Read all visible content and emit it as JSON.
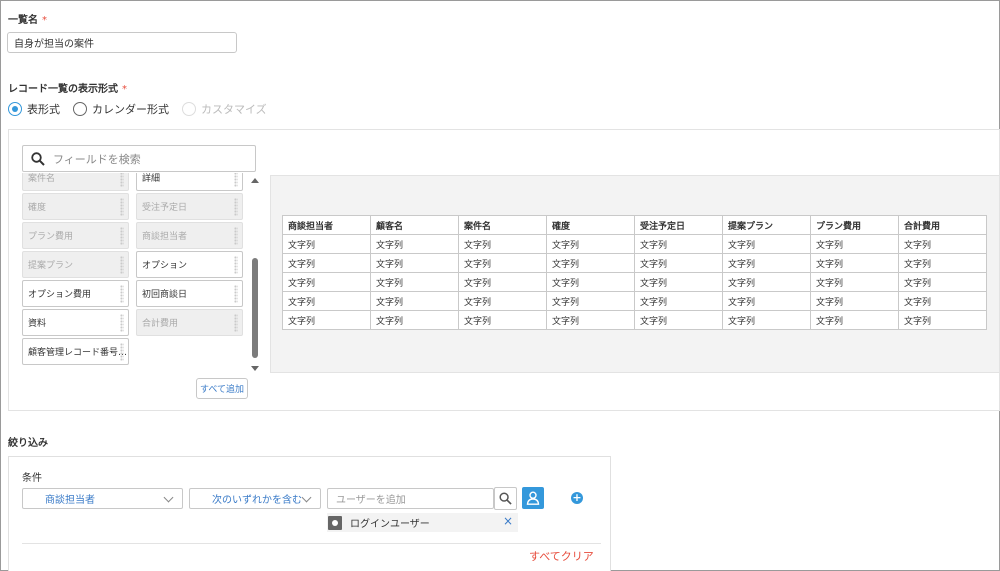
{
  "list_name": {
    "label": "一覧名",
    "required_mark": "*",
    "value": "自身が担当の案件"
  },
  "display_format": {
    "label": "レコード一覧の表示形式",
    "required_mark": "*",
    "options": [
      {
        "label": "表形式",
        "checked": true,
        "disabled": false
      },
      {
        "label": "カレンダー形式",
        "checked": false,
        "disabled": false
      },
      {
        "label": "カスタマイズ",
        "checked": false,
        "disabled": true
      }
    ]
  },
  "field_picker": {
    "search_placeholder": "フィールドを検索",
    "fields": [
      {
        "label": "案件名",
        "disabled": true
      },
      {
        "label": "詳細",
        "disabled": false
      },
      {
        "label": "確度",
        "disabled": true
      },
      {
        "label": "受注予定日",
        "disabled": true
      },
      {
        "label": "プラン費用",
        "disabled": true
      },
      {
        "label": "商談担当者",
        "disabled": true
      },
      {
        "label": "提案プラン",
        "disabled": true
      },
      {
        "label": "オプション",
        "disabled": false
      },
      {
        "label": "オプション費用",
        "disabled": false
      },
      {
        "label": "初回商談日",
        "disabled": false
      },
      {
        "label": "資料",
        "disabled": false
      },
      {
        "label": "合計費用",
        "disabled": true
      },
      {
        "label": "顧客管理レコード番号…",
        "disabled": false
      }
    ],
    "add_all_label": "すべて追加"
  },
  "preview_table": {
    "columns": [
      "商談担当者",
      "顧客名",
      "案件名",
      "確度",
      "受注予定日",
      "提案プラン",
      "プラン費用",
      "合計費用"
    ],
    "cell_text": "文字列",
    "row_count": 5
  },
  "filter": {
    "section_label": "絞り込み",
    "condition_label": "条件",
    "field_select": "商談担当者",
    "operator_select": "次のいずれかを含む",
    "user_input_placeholder": "ユーザーを追加",
    "selected_user": "ログインユーザー",
    "remove_symbol": "×",
    "add_symbol": "+",
    "clear_all_label": "すべてクリア"
  }
}
